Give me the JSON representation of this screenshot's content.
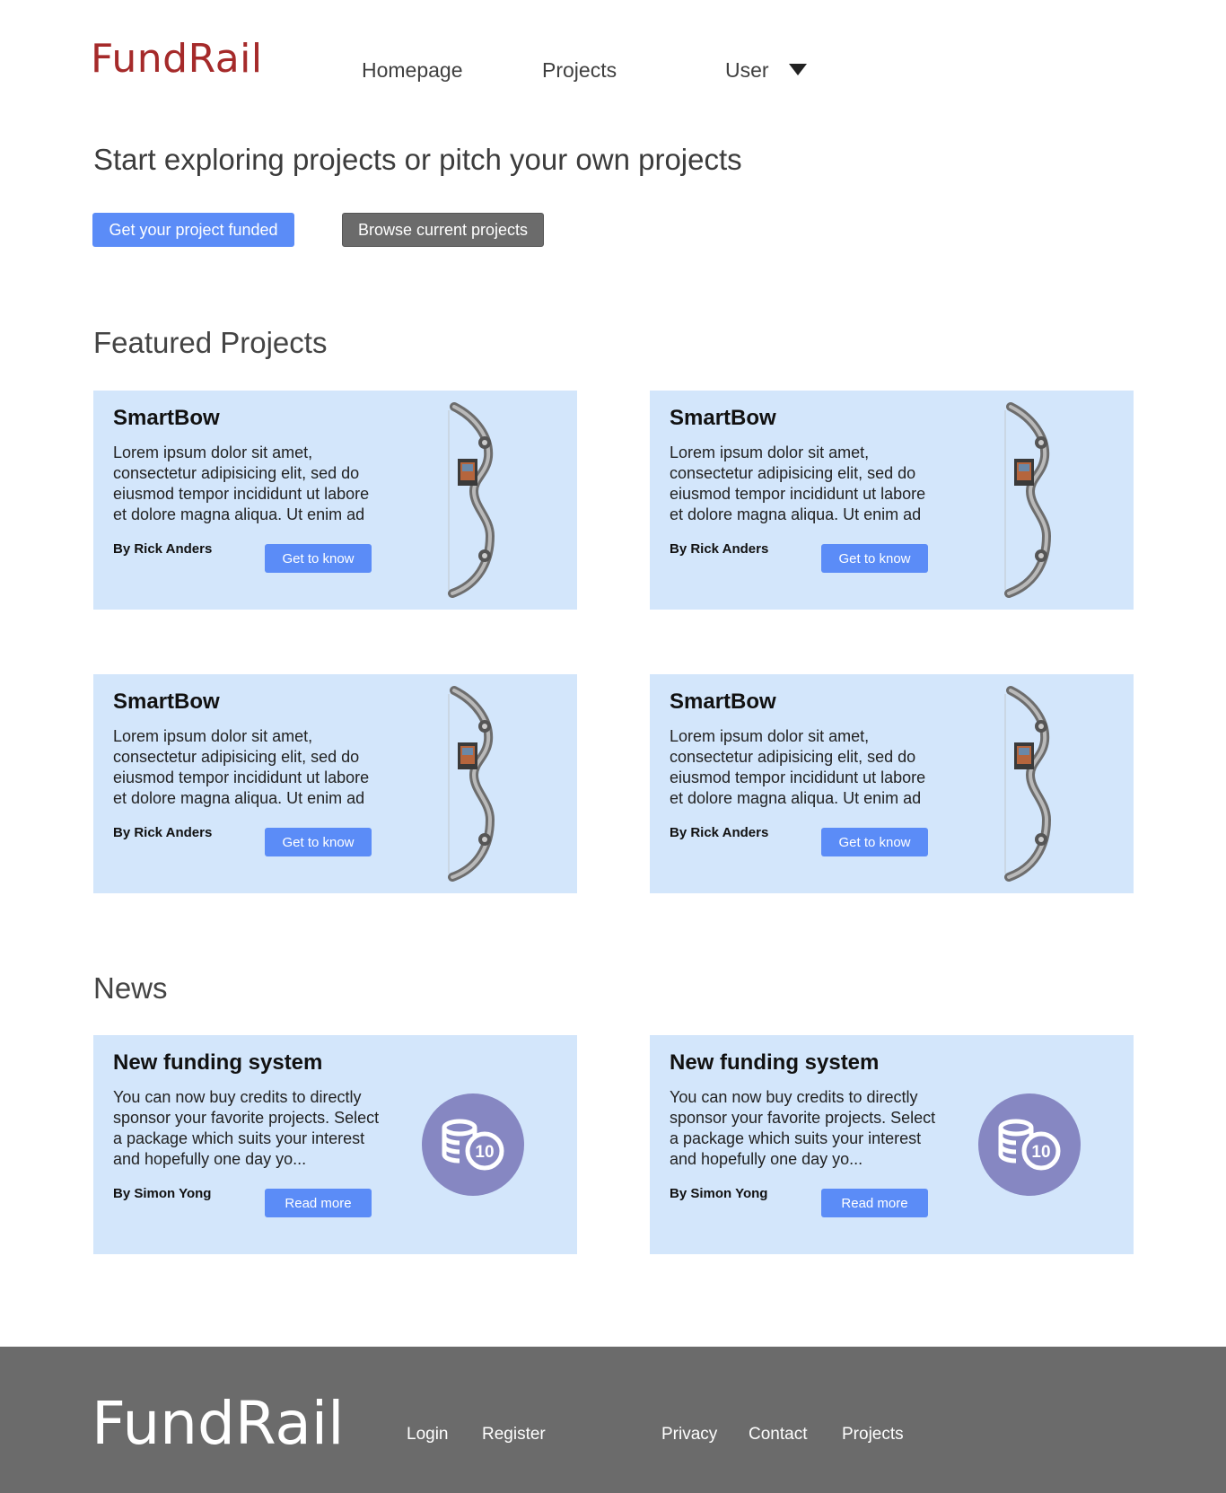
{
  "brand": {
    "logo": "FundRail",
    "color": "#a52a2a"
  },
  "nav": {
    "homepage": "Homepage",
    "projects": "Projects",
    "user": "User"
  },
  "hero": {
    "headline": "Start exploring projects or pitch your own projects",
    "primary_button": "Get your project funded",
    "secondary_button": "Browse current projects"
  },
  "featured": {
    "title": "Featured Projects",
    "cards": [
      {
        "title": "SmartBow",
        "text": "Lorem ipsum dolor sit amet, consectetur adipisicing elit, sed do eiusmod tempor incididunt ut labore et dolore magna aliqua. Ut enim ad",
        "author": "By Rick Anders",
        "button": "Get to know",
        "image": "compound-bow-image"
      },
      {
        "title": "SmartBow",
        "text": "Lorem ipsum dolor sit amet, consectetur adipisicing elit, sed do eiusmod tempor incididunt ut labore et dolore magna aliqua. Ut enim ad",
        "author": "By Rick Anders",
        "button": "Get to know",
        "image": "compound-bow-image"
      },
      {
        "title": "SmartBow",
        "text": "Lorem ipsum dolor sit amet, consectetur adipisicing elit, sed do eiusmod tempor incididunt ut labore et dolore magna aliqua. Ut enim ad",
        "author": "By Rick Anders",
        "button": "Get to know",
        "image": "compound-bow-image"
      },
      {
        "title": "SmartBow",
        "text": "Lorem ipsum dolor sit amet, consectetur adipisicing elit, sed do eiusmod tempor incididunt ut labore et dolore magna aliqua. Ut enim ad",
        "author": "By Rick Anders",
        "button": "Get to know",
        "image": "compound-bow-image"
      }
    ]
  },
  "news": {
    "title": "News",
    "cards": [
      {
        "title": "New funding system",
        "text": "You can now buy credits to directly sponsor your favorite projects. Select a package which suits your interest and hopefully one day yo...",
        "author": "By Simon Yong",
        "button": "Read more",
        "icon": "coins-icon",
        "coin_value": "10"
      },
      {
        "title": "New funding system",
        "text": "You can now buy credits to directly sponsor your favorite projects. Select a package which suits your interest and hopefully one day yo...",
        "author": "By Simon Yong",
        "button": "Read more",
        "icon": "coins-icon",
        "coin_value": "10"
      }
    ]
  },
  "footer": {
    "logo": "FundRail",
    "links": {
      "login": "Login",
      "register": "Register",
      "privacy": "Privacy",
      "contact": "Contact",
      "projects": "Projects"
    }
  },
  "colors": {
    "accent": "#5b8cf7",
    "card_bg": "#d3e6fb",
    "footer_bg": "#6b6b6b",
    "coin_bg": "#8687c2",
    "secondary_button": "#6b6b6b"
  }
}
